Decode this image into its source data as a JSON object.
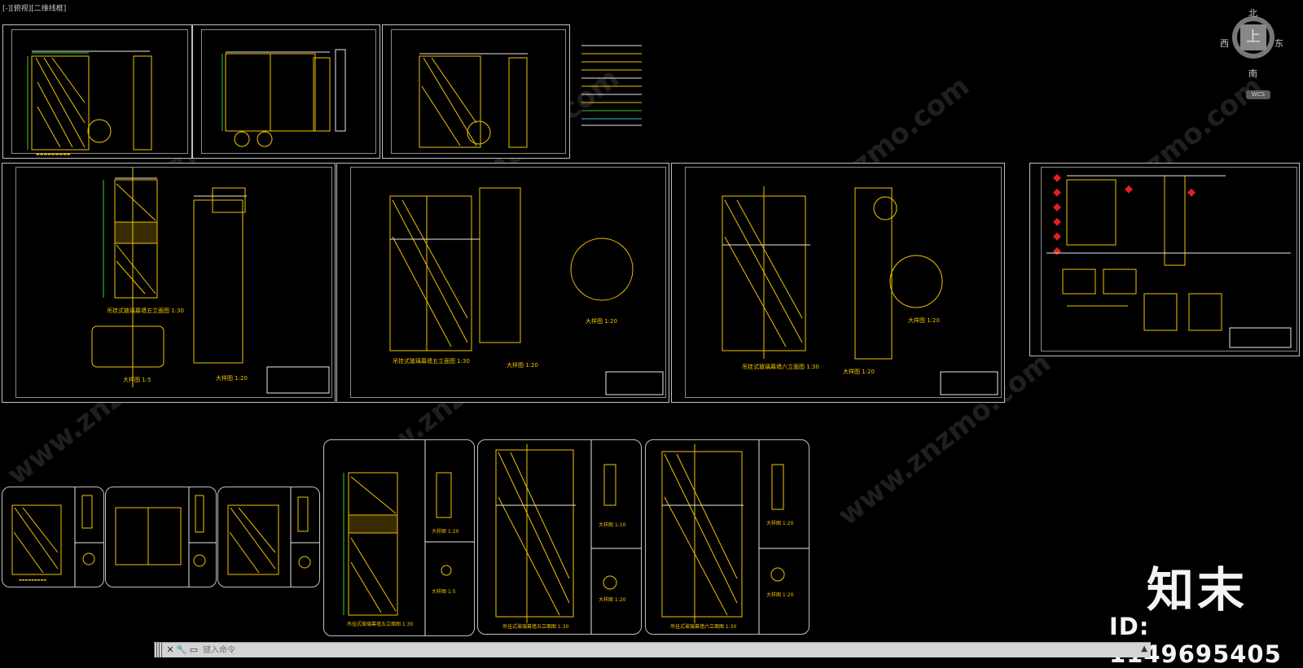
{
  "viewport": {
    "label": "[-][俯视][二维线框]"
  },
  "navcube": {
    "top": "上",
    "north": "北",
    "south": "南",
    "east": "东",
    "west": "西",
    "wcs": "WCS"
  },
  "watermark": {
    "logo": "知末",
    "id": "ID: 1149695405",
    "site": "www.znzmo.com"
  },
  "command_line": {
    "placeholder": "键入命令"
  },
  "colors": {
    "background": "#000000",
    "yellow": "#f2c200",
    "green": "#33cc33",
    "white": "#e8e8e8",
    "red": "#e02020",
    "cyan": "#22c8d8"
  },
  "sheet_titles": {
    "s4_left": "吊挂式玻璃幕墙五立面图 1:30",
    "s4_detail1": "大样图 1:20",
    "s4_detail2": "大样图 1:5",
    "s5_left": "吊挂式玻璃幕墙五立面图 1:30",
    "s5_detail1": "大样图 1:20",
    "s5_detail2": "大样图 1:20",
    "s6_left": "吊挂式玻璃幕墙六立面图 1:30",
    "s6_detail1": "大样图 1:20",
    "s6_detail2": "大样图 1:20",
    "b4_title": "吊挂式玻璃幕墙五立面图 1:30",
    "b4_d1": "大样图 1:20",
    "b4_d2": "大样图 1:5",
    "b5_title": "吊挂式玻璃幕墙五立面图 1:30",
    "b5_d1": "大样图 1:10",
    "b5_d2": "大样图 1:20",
    "b6_title": "吊挂式玻璃幕墙六立面图 1:30",
    "b6_d1": "大样图 1:20",
    "b6_d2": "大样图 1:20"
  }
}
